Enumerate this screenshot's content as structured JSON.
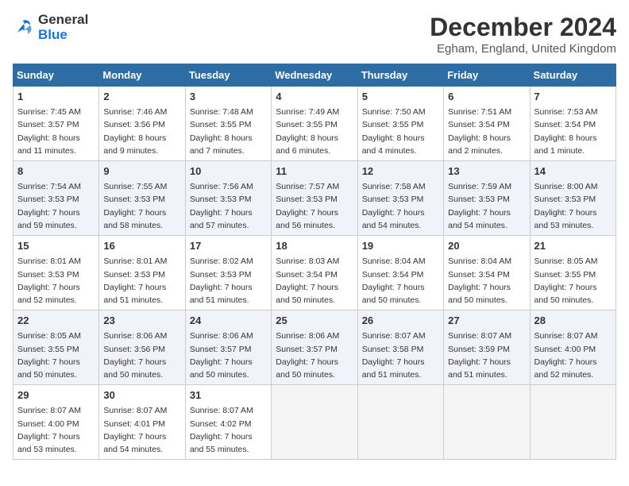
{
  "logo": {
    "line1": "General",
    "line2": "Blue"
  },
  "title": "December 2024",
  "subtitle": "Egham, England, United Kingdom",
  "weekdays": [
    "Sunday",
    "Monday",
    "Tuesday",
    "Wednesday",
    "Thursday",
    "Friday",
    "Saturday"
  ],
  "weeks": [
    [
      {
        "day": "1",
        "sunrise": "7:45 AM",
        "sunset": "3:57 PM",
        "daylight": "8 hours and 11 minutes."
      },
      {
        "day": "2",
        "sunrise": "7:46 AM",
        "sunset": "3:56 PM",
        "daylight": "8 hours and 9 minutes."
      },
      {
        "day": "3",
        "sunrise": "7:48 AM",
        "sunset": "3:55 PM",
        "daylight": "8 hours and 7 minutes."
      },
      {
        "day": "4",
        "sunrise": "7:49 AM",
        "sunset": "3:55 PM",
        "daylight": "8 hours and 6 minutes."
      },
      {
        "day": "5",
        "sunrise": "7:50 AM",
        "sunset": "3:55 PM",
        "daylight": "8 hours and 4 minutes."
      },
      {
        "day": "6",
        "sunrise": "7:51 AM",
        "sunset": "3:54 PM",
        "daylight": "8 hours and 2 minutes."
      },
      {
        "day": "7",
        "sunrise": "7:53 AM",
        "sunset": "3:54 PM",
        "daylight": "8 hours and 1 minute."
      }
    ],
    [
      {
        "day": "8",
        "sunrise": "7:54 AM",
        "sunset": "3:53 PM",
        "daylight": "7 hours and 59 minutes."
      },
      {
        "day": "9",
        "sunrise": "7:55 AM",
        "sunset": "3:53 PM",
        "daylight": "7 hours and 58 minutes."
      },
      {
        "day": "10",
        "sunrise": "7:56 AM",
        "sunset": "3:53 PM",
        "daylight": "7 hours and 57 minutes."
      },
      {
        "day": "11",
        "sunrise": "7:57 AM",
        "sunset": "3:53 PM",
        "daylight": "7 hours and 56 minutes."
      },
      {
        "day": "12",
        "sunrise": "7:58 AM",
        "sunset": "3:53 PM",
        "daylight": "7 hours and 54 minutes."
      },
      {
        "day": "13",
        "sunrise": "7:59 AM",
        "sunset": "3:53 PM",
        "daylight": "7 hours and 54 minutes."
      },
      {
        "day": "14",
        "sunrise": "8:00 AM",
        "sunset": "3:53 PM",
        "daylight": "7 hours and 53 minutes."
      }
    ],
    [
      {
        "day": "15",
        "sunrise": "8:01 AM",
        "sunset": "3:53 PM",
        "daylight": "7 hours and 52 minutes."
      },
      {
        "day": "16",
        "sunrise": "8:01 AM",
        "sunset": "3:53 PM",
        "daylight": "7 hours and 51 minutes."
      },
      {
        "day": "17",
        "sunrise": "8:02 AM",
        "sunset": "3:53 PM",
        "daylight": "7 hours and 51 minutes."
      },
      {
        "day": "18",
        "sunrise": "8:03 AM",
        "sunset": "3:54 PM",
        "daylight": "7 hours and 50 minutes."
      },
      {
        "day": "19",
        "sunrise": "8:04 AM",
        "sunset": "3:54 PM",
        "daylight": "7 hours and 50 minutes."
      },
      {
        "day": "20",
        "sunrise": "8:04 AM",
        "sunset": "3:54 PM",
        "daylight": "7 hours and 50 minutes."
      },
      {
        "day": "21",
        "sunrise": "8:05 AM",
        "sunset": "3:55 PM",
        "daylight": "7 hours and 50 minutes."
      }
    ],
    [
      {
        "day": "22",
        "sunrise": "8:05 AM",
        "sunset": "3:55 PM",
        "daylight": "7 hours and 50 minutes."
      },
      {
        "day": "23",
        "sunrise": "8:06 AM",
        "sunset": "3:56 PM",
        "daylight": "7 hours and 50 minutes."
      },
      {
        "day": "24",
        "sunrise": "8:06 AM",
        "sunset": "3:57 PM",
        "daylight": "7 hours and 50 minutes."
      },
      {
        "day": "25",
        "sunrise": "8:06 AM",
        "sunset": "3:57 PM",
        "daylight": "7 hours and 50 minutes."
      },
      {
        "day": "26",
        "sunrise": "8:07 AM",
        "sunset": "3:58 PM",
        "daylight": "7 hours and 51 minutes."
      },
      {
        "day": "27",
        "sunrise": "8:07 AM",
        "sunset": "3:59 PM",
        "daylight": "7 hours and 51 minutes."
      },
      {
        "day": "28",
        "sunrise": "8:07 AM",
        "sunset": "4:00 PM",
        "daylight": "7 hours and 52 minutes."
      }
    ],
    [
      {
        "day": "29",
        "sunrise": "8:07 AM",
        "sunset": "4:00 PM",
        "daylight": "7 hours and 53 minutes."
      },
      {
        "day": "30",
        "sunrise": "8:07 AM",
        "sunset": "4:01 PM",
        "daylight": "7 hours and 54 minutes."
      },
      {
        "day": "31",
        "sunrise": "8:07 AM",
        "sunset": "4:02 PM",
        "daylight": "7 hours and 55 minutes."
      },
      null,
      null,
      null,
      null
    ]
  ],
  "labels": {
    "sunrise": "Sunrise:",
    "sunset": "Sunset:",
    "daylight": "Daylight:"
  }
}
